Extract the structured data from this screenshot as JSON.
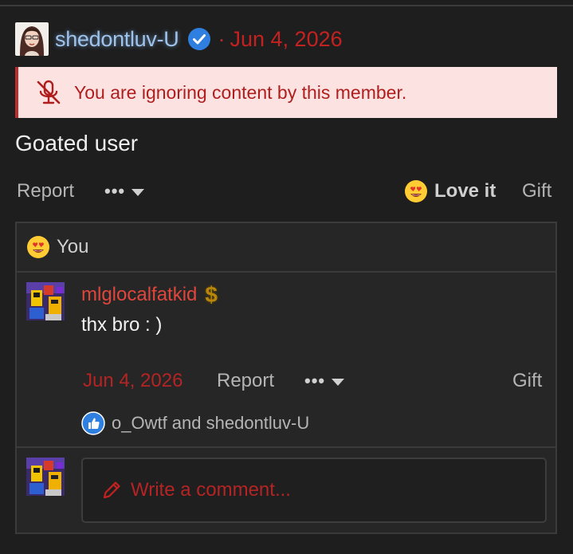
{
  "post": {
    "username": "shedontluv-U",
    "separator": "·",
    "date": "Jun 4, 2026",
    "ignore_notice": "You are ignoring content by this member.",
    "body": "Goated user",
    "actions": {
      "report": "Report",
      "more": "•••",
      "love": "Love it",
      "gift": "Gift"
    }
  },
  "reactions": {
    "summary": "You",
    "summary_icon": "heart-eyes-emoji"
  },
  "comment": {
    "username": "mlglocalfatkid",
    "badge": "$",
    "text": "thx bro : )",
    "date": "Jun 4, 2026",
    "report": "Report",
    "more": "•••",
    "gift": "Gift",
    "likes": "o_Owtf and shedontluv-U"
  },
  "write_comment": {
    "placeholder": "Write a comment..."
  },
  "colors": {
    "background": "#1e1e1e",
    "username_glow": "#9fc3ea",
    "date_red": "#c42121",
    "banner_bg": "#fde2e2",
    "banner_text": "#b01d1d",
    "comment_username": "#e0463c",
    "verified_blue": "#2f7fe0"
  }
}
